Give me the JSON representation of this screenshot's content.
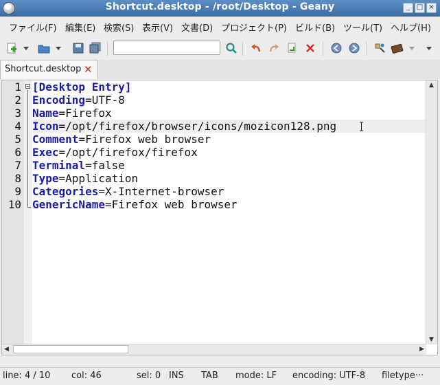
{
  "window": {
    "title": "Shortcut.desktop - /root/Desktop - Geany"
  },
  "menu": {
    "items": [
      "ファイル(F)",
      "編集(E)",
      "検索(S)",
      "表示(V)",
      "文書(D)",
      "プロジェクト(P)",
      "ビルド(B)",
      "ツール(T)",
      "ヘルプ(H)"
    ]
  },
  "toolbar": {
    "search_value": "",
    "icons": [
      "new-file-icon",
      "open-file-icon",
      "save-icon",
      "save-all-icon",
      "clear-search-icon",
      "find-icon",
      "undo-icon",
      "redo-icon",
      "next-icon",
      "close-icon",
      "back-icon",
      "forward-icon",
      "compile-icon",
      "build-icon"
    ]
  },
  "tabs": [
    {
      "label": "Shortcut.desktop"
    }
  ],
  "editor": {
    "lines": [
      {
        "num": "1",
        "parts": [
          {
            "t": "[Desktop Entry]",
            "c": "section"
          }
        ]
      },
      {
        "num": "2",
        "parts": [
          {
            "t": "Encoding",
            "c": "key"
          },
          {
            "t": "=UTF-8",
            "c": ""
          }
        ]
      },
      {
        "num": "3",
        "parts": [
          {
            "t": "Name",
            "c": "key"
          },
          {
            "t": "=Firefox",
            "c": ""
          }
        ]
      },
      {
        "num": "4",
        "parts": [
          {
            "t": "Icon",
            "c": "key"
          },
          {
            "t": "=/opt/firefox/browser/icons/mozicon128.png",
            "c": ""
          }
        ]
      },
      {
        "num": "5",
        "parts": [
          {
            "t": "Comment",
            "c": "key"
          },
          {
            "t": "=Firefox web browser",
            "c": ""
          }
        ]
      },
      {
        "num": "6",
        "parts": [
          {
            "t": "Exec",
            "c": "key"
          },
          {
            "t": "=/opt/firefox/firefox",
            "c": ""
          }
        ]
      },
      {
        "num": "7",
        "parts": [
          {
            "t": "Terminal",
            "c": "key"
          },
          {
            "t": "=false",
            "c": ""
          }
        ]
      },
      {
        "num": "8",
        "parts": [
          {
            "t": "Type",
            "c": "key"
          },
          {
            "t": "=Application",
            "c": ""
          }
        ]
      },
      {
        "num": "9",
        "parts": [
          {
            "t": "Categories",
            "c": "key"
          },
          {
            "t": "=X-Internet-browser",
            "c": ""
          }
        ]
      },
      {
        "num": "10",
        "parts": [
          {
            "t": "GenericName",
            "c": "key"
          },
          {
            "t": "=Firefox web browser",
            "c": ""
          }
        ]
      }
    ]
  },
  "status": {
    "line": "line: 4 / 10",
    "col": "col: 46",
    "sel": "sel: 0",
    "mode_ins": "INS",
    "tab": "TAB",
    "eol": "mode: LF",
    "encoding": "encoding: UTF-8",
    "filetype": "filetype···"
  },
  "colors": {
    "titlebar": "#3a6ea5",
    "key": "#1a1aa8",
    "tab_close": "#d62828"
  }
}
